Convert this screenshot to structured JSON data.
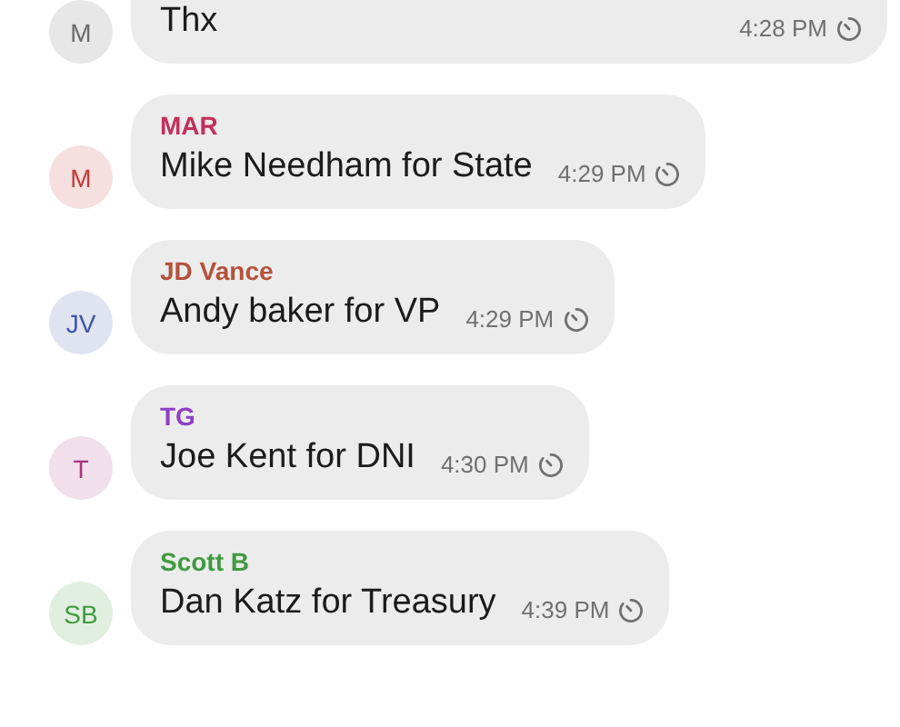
{
  "messages": [
    {
      "avatar": {
        "initials": "M",
        "color": "#6b6b6b"
      },
      "text": "Thx",
      "time": "4:28 PM"
    },
    {
      "avatar": {
        "initials": "M",
        "color": "#c23a3a"
      },
      "sender": {
        "name": "MAR",
        "color": "#c2305a"
      },
      "text": "Mike Needham for State",
      "time": "4:29 PM"
    },
    {
      "avatar": {
        "initials": "JV",
        "color": "#3d55a8"
      },
      "sender": {
        "name": "JD Vance",
        "color": "#b4523a"
      },
      "text": "Andy baker for VP",
      "time": "4:29 PM"
    },
    {
      "avatar": {
        "initials": "T",
        "color": "#a8347f"
      },
      "sender": {
        "name": "TG",
        "color": "#8e3fc6"
      },
      "text": "Joe Kent for DNI",
      "time": "4:30 PM"
    },
    {
      "avatar": {
        "initials": "SB",
        "color": "#3f9a3f"
      },
      "sender": {
        "name": "Scott B",
        "color": "#3f9a3f"
      },
      "text": "Dan Katz for Treasury",
      "time": "4:39 PM"
    }
  ]
}
